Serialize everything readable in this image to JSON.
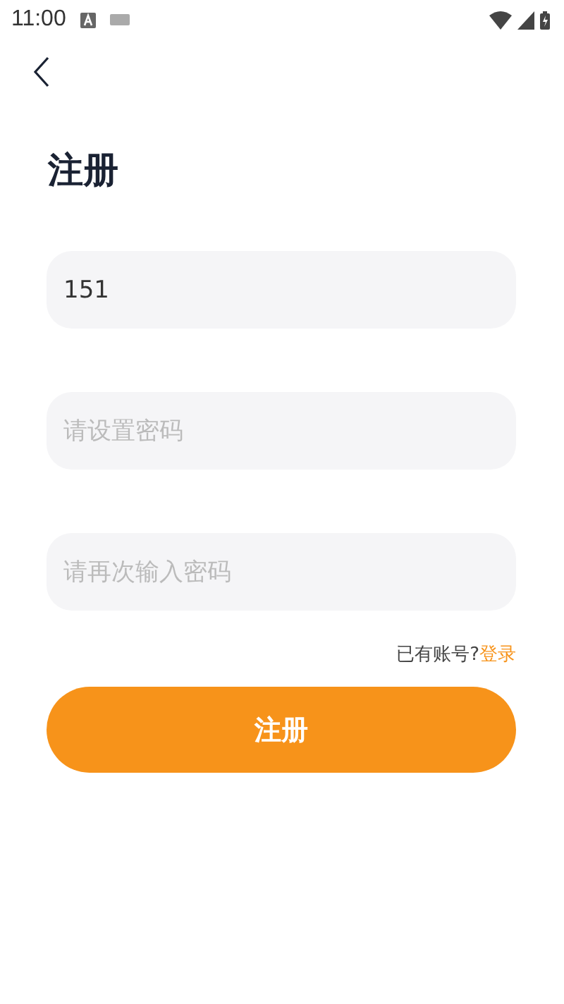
{
  "status_bar": {
    "time": "11:00"
  },
  "title": "注册",
  "fields": [
    {
      "value": "151"
    },
    {
      "placeholder": "请设置密码"
    },
    {
      "placeholder": "请再次输入密码"
    }
  ],
  "login_prompt": {
    "text": "已有账号?",
    "link": "登录"
  },
  "submit_button": "注册"
}
